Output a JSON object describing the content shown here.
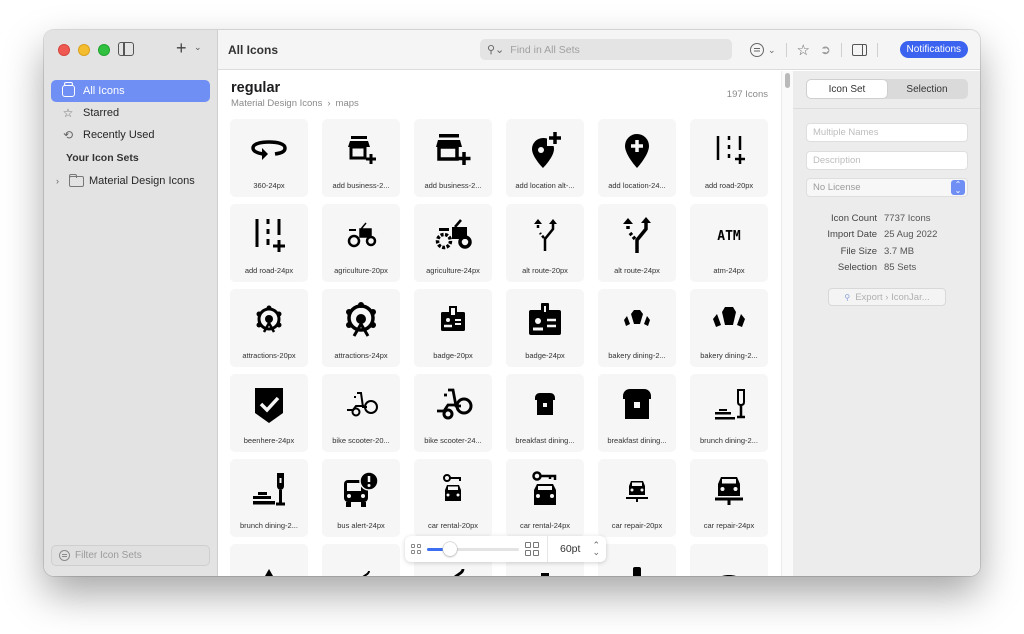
{
  "window": {
    "traffic_lights": [
      "close",
      "minimize",
      "zoom"
    ]
  },
  "sidebar": {
    "add_label": "+",
    "items": [
      {
        "label": "All Icons",
        "icon": "jar-icon",
        "active": true
      },
      {
        "label": "Starred",
        "icon": "star-icon",
        "active": false
      },
      {
        "label": "Recently Used",
        "icon": "clock-icon",
        "active": false
      }
    ],
    "section_header": "Your Icon Sets",
    "icon_sets": [
      {
        "label": "Material Design Icons",
        "icon": "folder-icon",
        "expanded": false
      }
    ],
    "filter_placeholder": "Filter Icon Sets"
  },
  "toolbar": {
    "title": "All Icons",
    "search_placeholder": "Find in All Sets",
    "notifications_label": "Notifications"
  },
  "main": {
    "set_title": "regular",
    "breadcrumb": [
      "Material Design Icons",
      "maps"
    ],
    "breadcrumb_sep": "›",
    "count_label": "197 Icons",
    "icons": [
      {
        "label": "360-24px",
        "glyph": "rotate-360"
      },
      {
        "label": "add business-2...",
        "glyph": "add-business-small"
      },
      {
        "label": "add business-2...",
        "glyph": "add-business"
      },
      {
        "label": "add location alt-...",
        "glyph": "add-location-alt"
      },
      {
        "label": "add location-24...",
        "glyph": "add-location"
      },
      {
        "label": "add road-20px",
        "glyph": "add-road-small"
      },
      {
        "label": "add road-24px",
        "glyph": "add-road"
      },
      {
        "label": "agriculture-20px",
        "glyph": "agriculture-small"
      },
      {
        "label": "agriculture-24px",
        "glyph": "agriculture"
      },
      {
        "label": "alt route-20px",
        "glyph": "alt-route-small"
      },
      {
        "label": "alt route-24px",
        "glyph": "alt-route"
      },
      {
        "label": "atm-24px",
        "glyph": "atm"
      },
      {
        "label": "attractions-20px",
        "glyph": "attractions-small"
      },
      {
        "label": "attractions-24px",
        "glyph": "attractions"
      },
      {
        "label": "badge-20px",
        "glyph": "badge-small"
      },
      {
        "label": "badge-24px",
        "glyph": "badge"
      },
      {
        "label": "bakery dining-2...",
        "glyph": "bakery-small"
      },
      {
        "label": "bakery dining-2...",
        "glyph": "bakery"
      },
      {
        "label": "beenhere-24px",
        "glyph": "beenhere"
      },
      {
        "label": "bike scooter-20...",
        "glyph": "bike-scooter-small"
      },
      {
        "label": "bike scooter-24...",
        "glyph": "bike-scooter"
      },
      {
        "label": "breakfast dining...",
        "glyph": "breakfast-small"
      },
      {
        "label": "breakfast dining...",
        "glyph": "breakfast"
      },
      {
        "label": "brunch dining-2...",
        "glyph": "brunch-small"
      },
      {
        "label": "brunch dining-2...",
        "glyph": "brunch"
      },
      {
        "label": "bus alert-24px",
        "glyph": "bus-alert"
      },
      {
        "label": "car rental-20px",
        "glyph": "car-rental-small"
      },
      {
        "label": "car rental-24px",
        "glyph": "car-rental"
      },
      {
        "label": "car repair-20px",
        "glyph": "car-repair-small"
      },
      {
        "label": "car repair-24px",
        "glyph": "car-repair"
      },
      {
        "label": "",
        "glyph": "category-partial"
      },
      {
        "label": "",
        "glyph": "celebration-small-partial"
      },
      {
        "label": "",
        "glyph": "celebration-partial"
      },
      {
        "label": "",
        "glyph": "dining-small-partial"
      },
      {
        "label": "",
        "glyph": "dining-partial"
      },
      {
        "label": "",
        "glyph": "wifi-partial"
      }
    ]
  },
  "zoom_control": {
    "size_label": "60pt",
    "slider_fraction": 0.2
  },
  "inspector": {
    "tabs": [
      {
        "label": "Icon Set",
        "active": true
      },
      {
        "label": "Selection",
        "active": false
      }
    ],
    "names_placeholder": "Multiple Names",
    "description_placeholder": "Description",
    "license_value": "No License",
    "meta": [
      {
        "key": "Icon Count",
        "value": "7737 Icons"
      },
      {
        "key": "Import Date",
        "value": "25 Aug 2022"
      },
      {
        "key": "File Size",
        "value": "3.7 MB"
      },
      {
        "key": "Selection",
        "value": "85 Sets"
      }
    ],
    "export_label": "Export › IconJar..."
  },
  "colors": {
    "accent": "#3b63f0",
    "sidebar_selection": "#6f8ff5",
    "sidebar_bg": "#e3e3e3",
    "inspector_bg": "#ececec"
  }
}
